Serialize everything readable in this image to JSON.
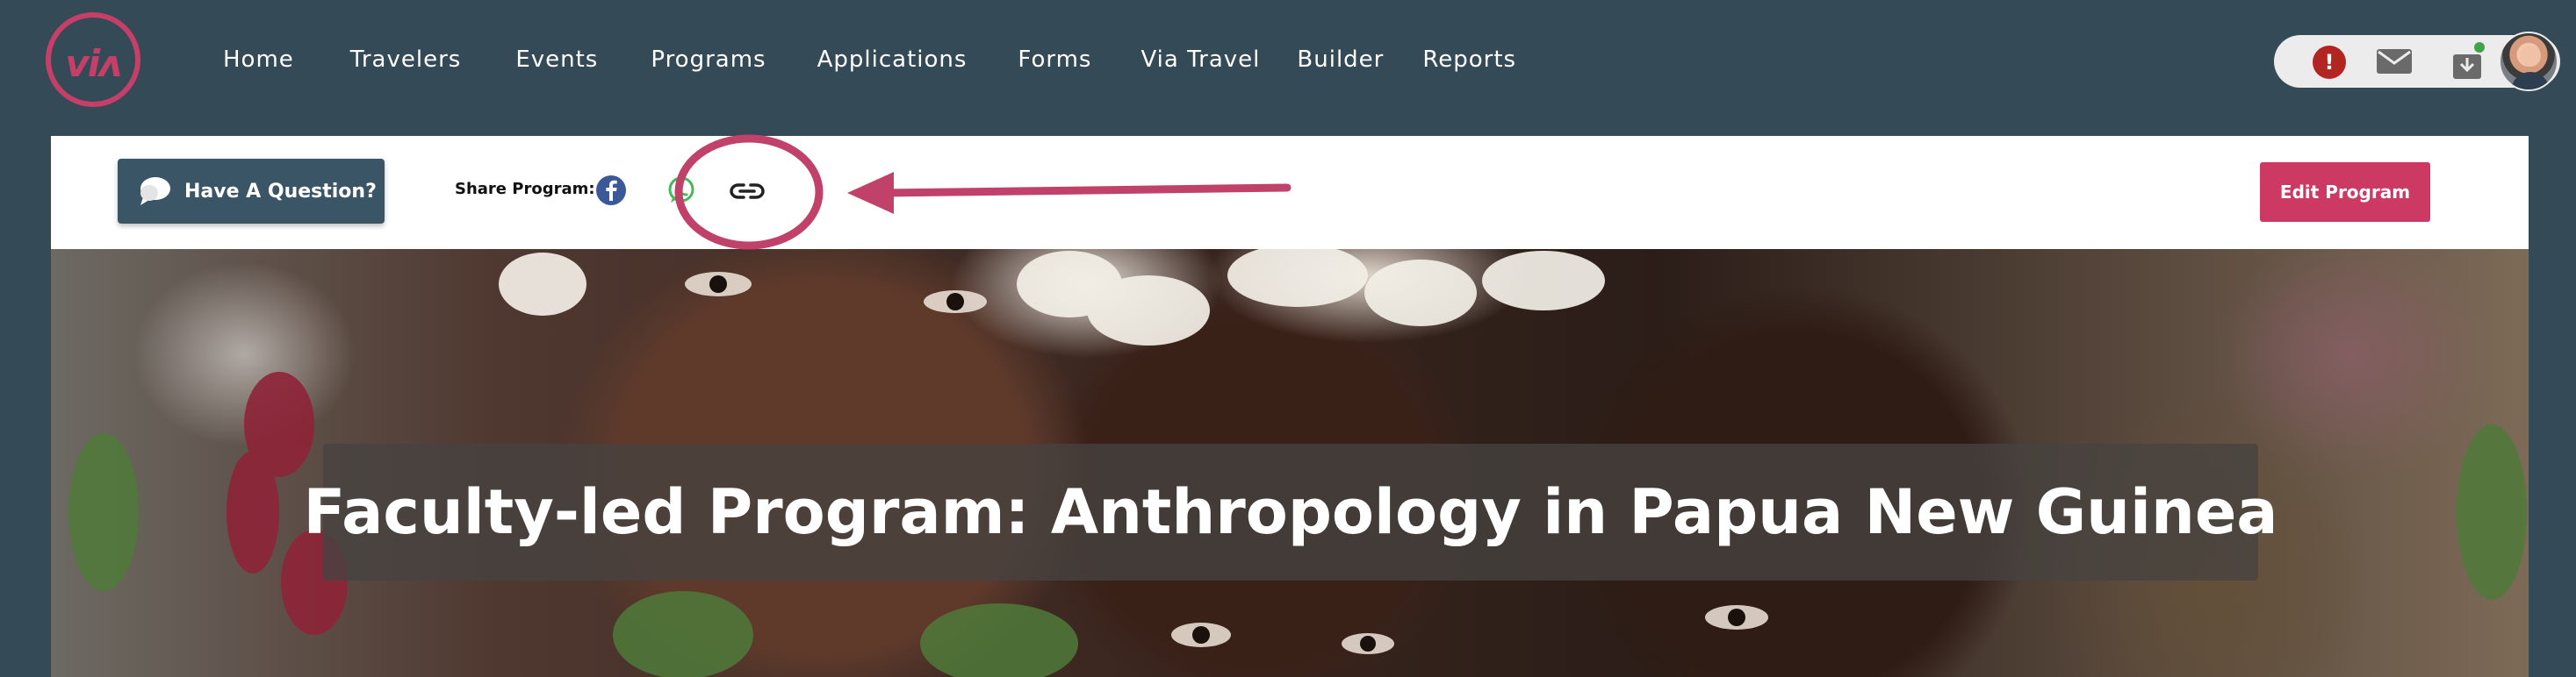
{
  "logo": {
    "text": "viʌ",
    "alt": "Via"
  },
  "nav": {
    "items": [
      {
        "label": "Home"
      },
      {
        "label": "Travelers"
      },
      {
        "label": "Events"
      },
      {
        "label": "Programs"
      },
      {
        "label": "Applications"
      },
      {
        "label": "Forms"
      },
      {
        "label": "Via Travel"
      },
      {
        "label": "Builder"
      },
      {
        "label": "Reports"
      }
    ]
  },
  "user_menu": {
    "alert_symbol": "!",
    "icons": [
      "alert-icon",
      "mail-icon",
      "download-icon",
      "avatar"
    ]
  },
  "action_bar": {
    "question_button_label": "Have A Question?",
    "share_label": "Share Program:",
    "share_icons": [
      "facebook-icon",
      "whatsapp-icon",
      "link-icon"
    ],
    "edit_button_label": "Edit Program"
  },
  "hero": {
    "title": "Faculty-led Program: Anthropology in Papua New Guinea"
  },
  "colors": {
    "header_bg": "#344a56",
    "brand_pink": "#c63f68",
    "button_dark": "#3a5666",
    "edit_button": "#cc3a64",
    "alert_red": "#b32521",
    "annotation": "#c0426b"
  }
}
